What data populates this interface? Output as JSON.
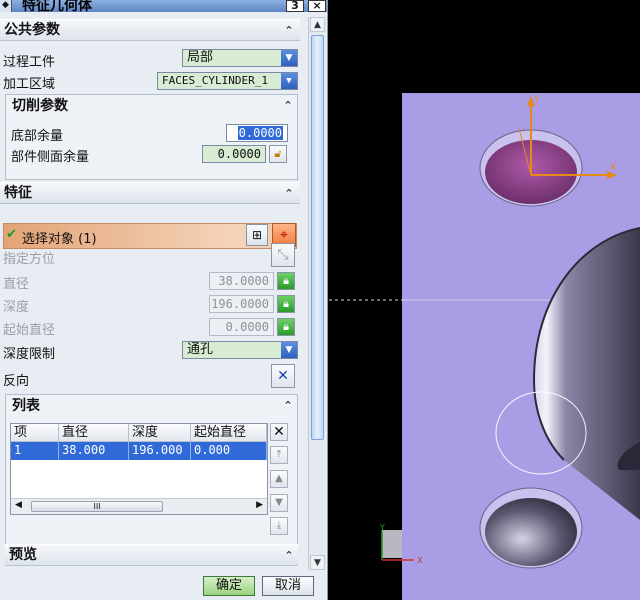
{
  "window": {
    "title": "特征几何体",
    "btn_restore": "3",
    "btn_close": "×"
  },
  "common_params": {
    "header": "公共参数",
    "process_workpiece_label": "过程工件",
    "process_workpiece_value": "局部",
    "cut_region_label": "加工区域",
    "cut_region_value": "FACES_CYLINDER_1"
  },
  "cut_params": {
    "header": "切削参数",
    "bottom_stock_label": "底部余量",
    "bottom_stock_value": "0.0000",
    "side_stock_label": "部件侧面余量",
    "side_stock_value": "0.0000"
  },
  "feature": {
    "header": "特征",
    "select_object_label": "选择对象 (1)",
    "specify_orientation_label": "指定方位",
    "diameter_label": "直径",
    "diameter_value": "38.0000",
    "depth_label": "深度",
    "depth_value": "196.0000",
    "start_diameter_label": "起始直径",
    "start_diameter_value": "0.0000",
    "depth_limit_label": "深度限制",
    "depth_limit_value": "通孔",
    "reverse_label": "反向"
  },
  "list": {
    "header": "列表",
    "columns": [
      "项",
      "直径",
      "深度",
      "起始直径"
    ],
    "rows": [
      [
        "1",
        "38.000",
        "196.000",
        "0.000"
      ]
    ],
    "scroll_grip": "III"
  },
  "preview": {
    "header": "预览"
  },
  "buttons": {
    "ok": "确定",
    "cancel": "取消"
  },
  "viewport": {
    "axis_y": "Y",
    "axis_x": "X"
  },
  "colors": {
    "model": "#a99ee6",
    "hole_fill": "#8a4a8a",
    "accent": "#2f6ad8"
  }
}
